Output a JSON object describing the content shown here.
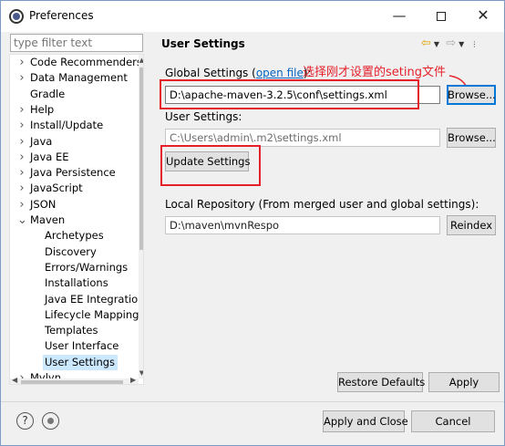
{
  "window": {
    "title": "Preferences",
    "minimize_glyph": "—",
    "close_glyph": "✕"
  },
  "sidebar": {
    "filter_placeholder": "type filter text",
    "items": [
      {
        "label": "Code Recommenders",
        "arrow": ">"
      },
      {
        "label": "Data Management",
        "arrow": ">"
      },
      {
        "label": "Gradle",
        "arrow": ""
      },
      {
        "label": "Help",
        "arrow": ">"
      },
      {
        "label": "Install/Update",
        "arrow": ">"
      },
      {
        "label": "Java",
        "arrow": ">"
      },
      {
        "label": "Java EE",
        "arrow": ">"
      },
      {
        "label": "Java Persistence",
        "arrow": ">"
      },
      {
        "label": "JavaScript",
        "arrow": ">"
      },
      {
        "label": "JSON",
        "arrow": ">"
      },
      {
        "label": "Maven",
        "arrow": "v"
      },
      {
        "label": "Archetypes",
        "arrow": ""
      },
      {
        "label": "Discovery",
        "arrow": ""
      },
      {
        "label": "Errors/Warnings",
        "arrow": ""
      },
      {
        "label": "Installations",
        "arrow": ""
      },
      {
        "label": "Java EE Integration",
        "arrow": ""
      },
      {
        "label": "Lifecycle Mapping",
        "arrow": ""
      },
      {
        "label": "Templates",
        "arrow": ""
      },
      {
        "label": "User Interface",
        "arrow": ""
      },
      {
        "label": "User Settings",
        "arrow": ""
      },
      {
        "label": "Mylyn",
        "arrow": ">"
      }
    ],
    "selected_item": "User Settings"
  },
  "main": {
    "title": "User Settings",
    "global_settings": {
      "label_prefix": "Global Settings (",
      "link_text": "open file",
      "label_suffix": "):",
      "value": "D:\\apache-maven-3.2.5\\conf\\settings.xml",
      "browse_label": "Browse..."
    },
    "user_settings": {
      "label": "User Settings:",
      "value": "C:\\Users\\admin\\.m2\\settings.xml",
      "browse_label": "Browse..."
    },
    "update_button": "Update Settings",
    "local_repo": {
      "label": "Local Repository (From merged user and global settings):",
      "value": "D:\\maven\\mvnRespo",
      "reindex_label": "Reindex"
    },
    "annotation": "选择刚才设置的seting文件",
    "annotation_color": "#e5202a",
    "restore_defaults": "Restore Defaults",
    "apply": "Apply"
  },
  "footer": {
    "help_icon": "?",
    "apply_and_close": "Apply and Close",
    "cancel": "Cancel"
  }
}
